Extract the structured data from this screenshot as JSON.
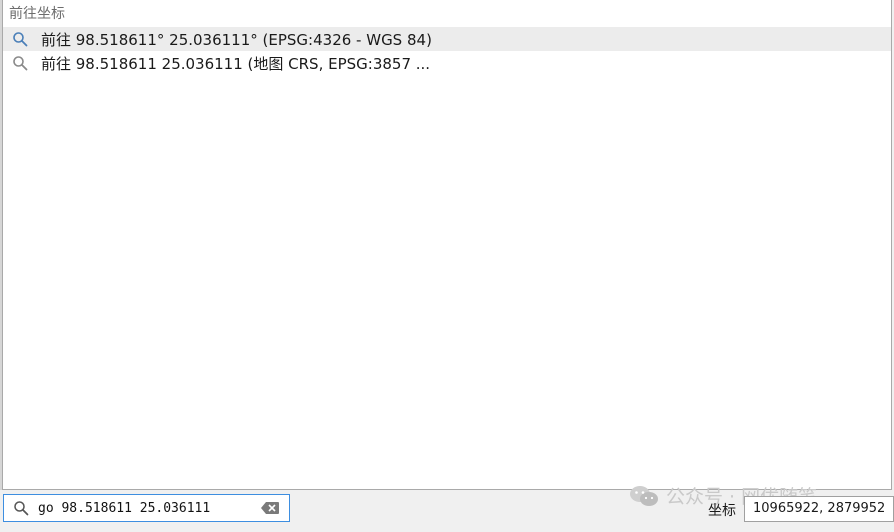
{
  "suggestions": {
    "group_title": "前往坐标",
    "results": [
      {
        "icon": "search-icon",
        "label": "前往 98.518611° 25.036111° (EPSG:4326 - WGS 84)",
        "selected": true
      },
      {
        "icon": "search-icon",
        "label": "前往 98.518611 25.036111 (地图 CRS, EPSG:3857 ...",
        "selected": false
      }
    ]
  },
  "locator": {
    "value": "go 98.518611 25.036111",
    "search_icon": "search-icon",
    "clear_icon": "backspace-clear-icon",
    "focus_color": "#3d8ee0"
  },
  "status_bar": {
    "coordinate_label": "坐标",
    "coordinate_value": "10965922, 2879952"
  },
  "watermark": {
    "icon": "wechat-icon",
    "text": "公众号 · 网优随笔"
  },
  "colors": {
    "selected_row": "#ececec",
    "background": "#f0f0f0"
  }
}
